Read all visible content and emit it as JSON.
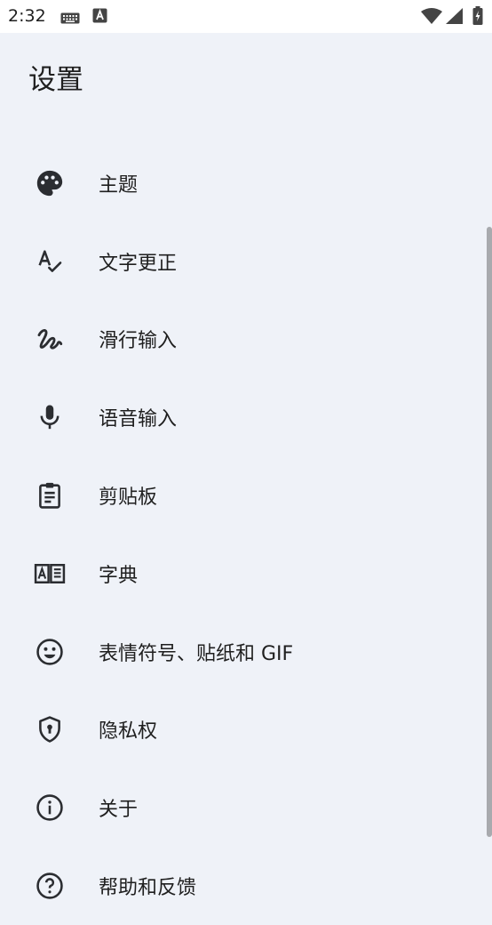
{
  "status_bar": {
    "time": "2:32",
    "icons": [
      "keyboard-icon",
      "a-icon",
      "wifi-icon",
      "signal-icon",
      "battery-charging-icon"
    ]
  },
  "header": {
    "title": "设置"
  },
  "settings": {
    "items": [
      {
        "label": "主题",
        "icon": "palette-icon"
      },
      {
        "label": "文字更正",
        "icon": "spellcheck-icon"
      },
      {
        "label": "滑行输入",
        "icon": "gesture-icon"
      },
      {
        "label": "语音输入",
        "icon": "mic-icon"
      },
      {
        "label": "剪贴板",
        "icon": "clipboard-icon"
      },
      {
        "label": "字典",
        "icon": "dictionary-icon"
      },
      {
        "label": "表情符号、贴纸和 GIF",
        "icon": "emoji-icon"
      },
      {
        "label": "隐私权",
        "icon": "privacy-shield-icon"
      },
      {
        "label": "关于",
        "icon": "info-icon"
      },
      {
        "label": "帮助和反馈",
        "icon": "help-icon"
      }
    ]
  },
  "colors": {
    "background": "#eff2f8",
    "status_bar_bg": "#ffffff",
    "text": "#1f1f1f",
    "icon": "#2b2d31",
    "scrollbar": "#a8aaae"
  }
}
